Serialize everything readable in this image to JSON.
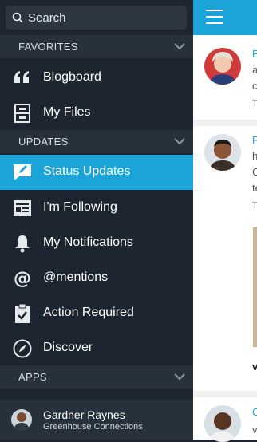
{
  "search": {
    "placeholder": "Search"
  },
  "sections": {
    "favorites": "FAVORITES",
    "updates": "UPDATES",
    "apps": "APPS"
  },
  "menu": {
    "blogboard": "Blogboard",
    "my_files": "My Files",
    "status_updates": "Status Updates",
    "following": "I'm Following",
    "notifications": "My Notifications",
    "mentions": "@mentions",
    "action_required": "Action Required",
    "discover": "Discover"
  },
  "user": {
    "name": "Gardner Raynes",
    "org": "Greenhouse Connections"
  },
  "colors": {
    "sidebar": "#1d2530",
    "section": "#27313c",
    "accent": "#1ba4d8"
  },
  "feed_fragments": {
    "p1": [
      "B",
      "a",
      "c",
      "T"
    ],
    "p2": [
      "F",
      "h",
      "C",
      "te",
      "T"
    ],
    "post_title": "v",
    "p3": [
      "C",
      "v"
    ]
  }
}
